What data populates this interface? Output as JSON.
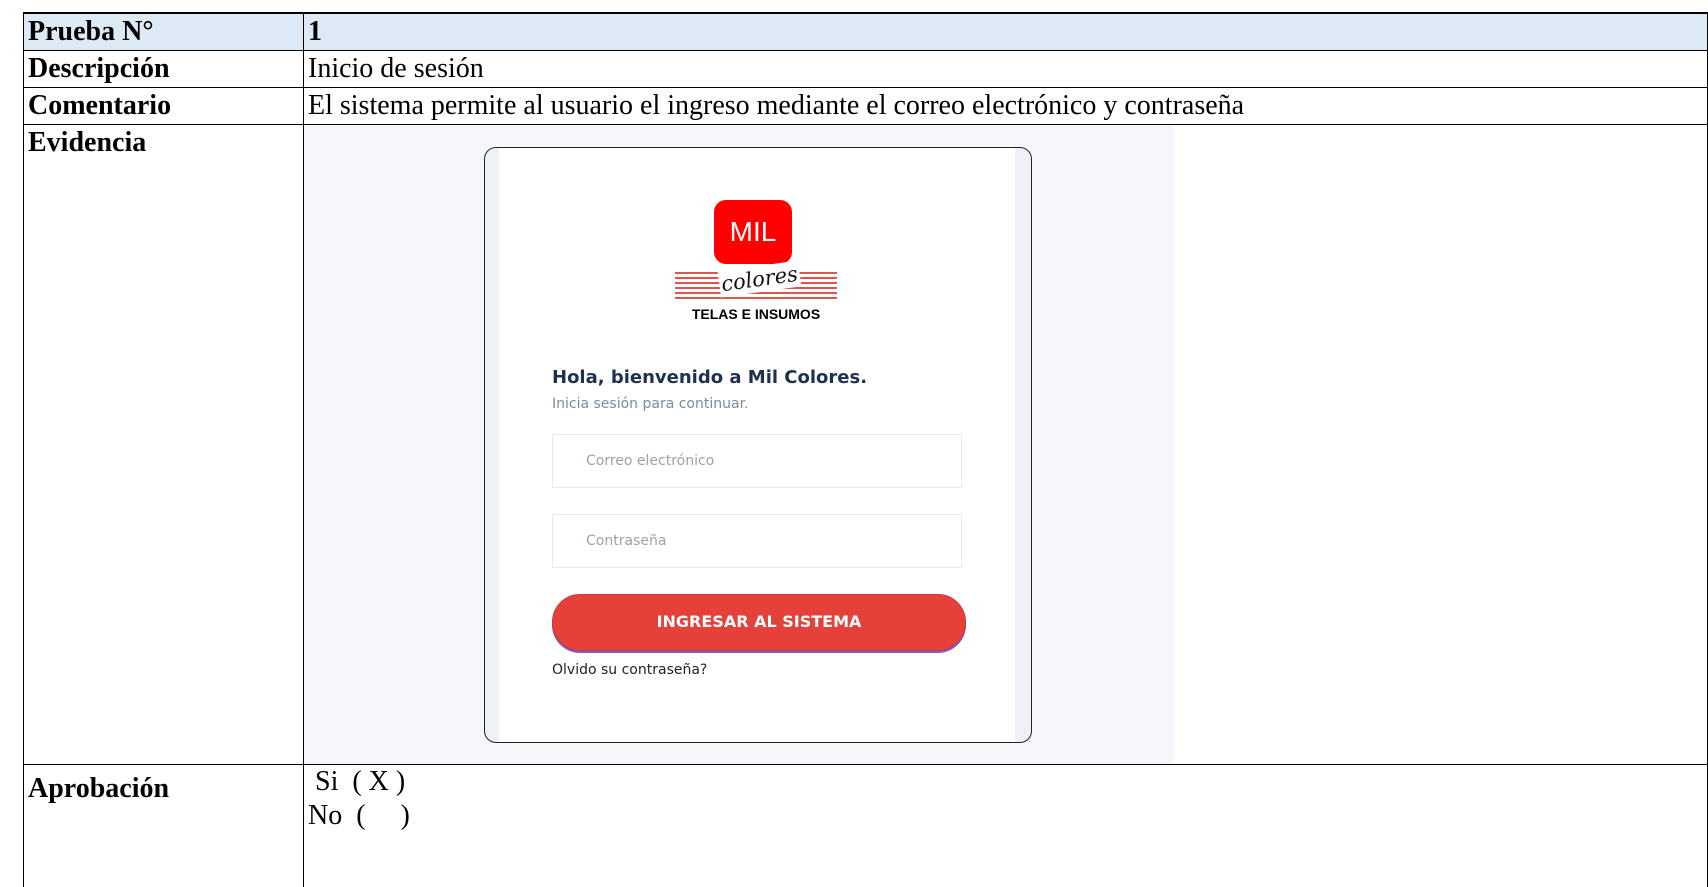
{
  "table": {
    "rows": [
      {
        "label": "Prueba N°",
        "value": "1"
      },
      {
        "label": "Descripción",
        "value": "Inicio de sesión"
      },
      {
        "label": "Comentario",
        "value": "El sistema permite al usuario el ingreso mediante el correo electrónico y contraseña"
      },
      {
        "label": "Evidencia"
      },
      {
        "label": "Aprobación",
        "options": [
          " Si  ( X )",
          "No  (     )"
        ]
      }
    ]
  },
  "evidence": {
    "logo": {
      "mil": "MIL",
      "colores": "colores",
      "tagline": "TELAS E INSUMOS"
    },
    "welcome": "Hola, bienvenido a Mil Colores.",
    "subtitle": "Inicia sesión para continuar.",
    "email_placeholder": "Correo electrónico",
    "password_placeholder": "Contraseña",
    "submit_label": "INGRESAR AL SISTEMA",
    "forgot_label": "Olvido su contraseña?",
    "colors": {
      "brand": "#ff0000",
      "button": "#e5403a",
      "header_row": "#dde9f5"
    }
  }
}
